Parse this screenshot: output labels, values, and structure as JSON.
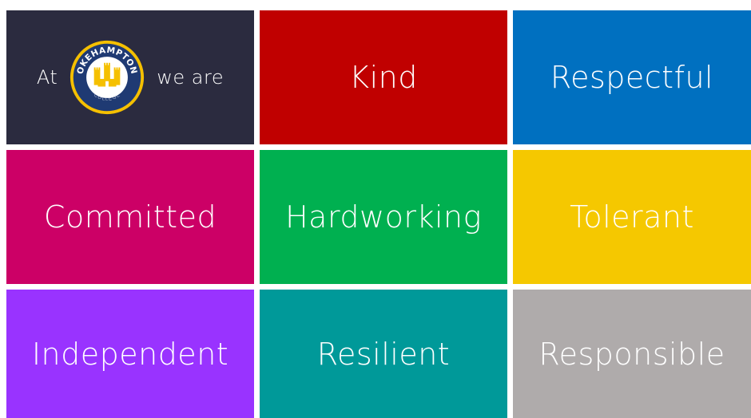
{
  "intro": {
    "prefix": "At",
    "suffix": "we are",
    "logo": {
      "top_text": "OKEHAMPTON",
      "bottom_text": "COLLEGE",
      "icon": "castle-crest-icon"
    },
    "bg": "#2b2b3f"
  },
  "values": [
    {
      "label": "Kind",
      "color": "#c00000"
    },
    {
      "label": "Respectful",
      "color": "#0070c0"
    },
    {
      "label": "Committed",
      "color": "#cc0066"
    },
    {
      "label": "Hardworking",
      "color": "#00b050"
    },
    {
      "label": "Tolerant",
      "color": "#f5c800"
    },
    {
      "label": "Independent",
      "color": "#9933ff"
    },
    {
      "label": "Resilient",
      "color": "#009999"
    },
    {
      "label": "Responsible",
      "color": "#afabab"
    }
  ],
  "logo_colors": {
    "ring": "#f5c000",
    "inner": "#1f3a73",
    "castle": "#f5c000"
  }
}
